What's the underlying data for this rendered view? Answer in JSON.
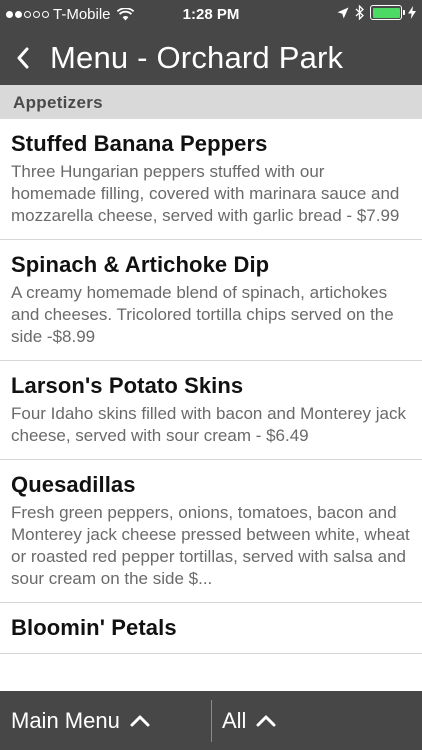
{
  "status_bar": {
    "carrier": "T-Mobile",
    "time": "1:28 PM",
    "battery_color": "#4cd964"
  },
  "nav": {
    "back_icon": "chevron-left-icon",
    "title": "Menu - Orchard Park"
  },
  "section": {
    "label": "Appetizers"
  },
  "items": [
    {
      "name": "Stuffed Banana Peppers",
      "description": "Three Hungarian peppers stuffed with our homemade filling, covered with marinara sauce and mozzarella cheese, served with garlic bread - $7.99"
    },
    {
      "name": "Spinach & Artichoke Dip",
      "description": "A creamy homemade blend of spinach, artichokes and cheeses. Tricolored tortilla chips served on the side -$8.99"
    },
    {
      "name": "Larson's Potato Skins",
      "description": "Four Idaho skins filled with bacon and Monterey jack cheese, served with sour cream - $6.49"
    },
    {
      "name": "Quesadillas",
      "description": "Fresh green peppers, onions, tomatoes, bacon and Monterey jack cheese pressed between white, wheat or roasted red pepper tortillas, served with salsa and sour cream on the side $..."
    },
    {
      "name": "Bloomin' Petals",
      "description": ""
    }
  ],
  "bottom_bar": {
    "main_menu_label": "Main Menu",
    "filter_label": "All",
    "chevron_icon": "chevron-up-icon"
  },
  "colors": {
    "bar_background": "#474747",
    "section_background": "#d9d9d9"
  }
}
